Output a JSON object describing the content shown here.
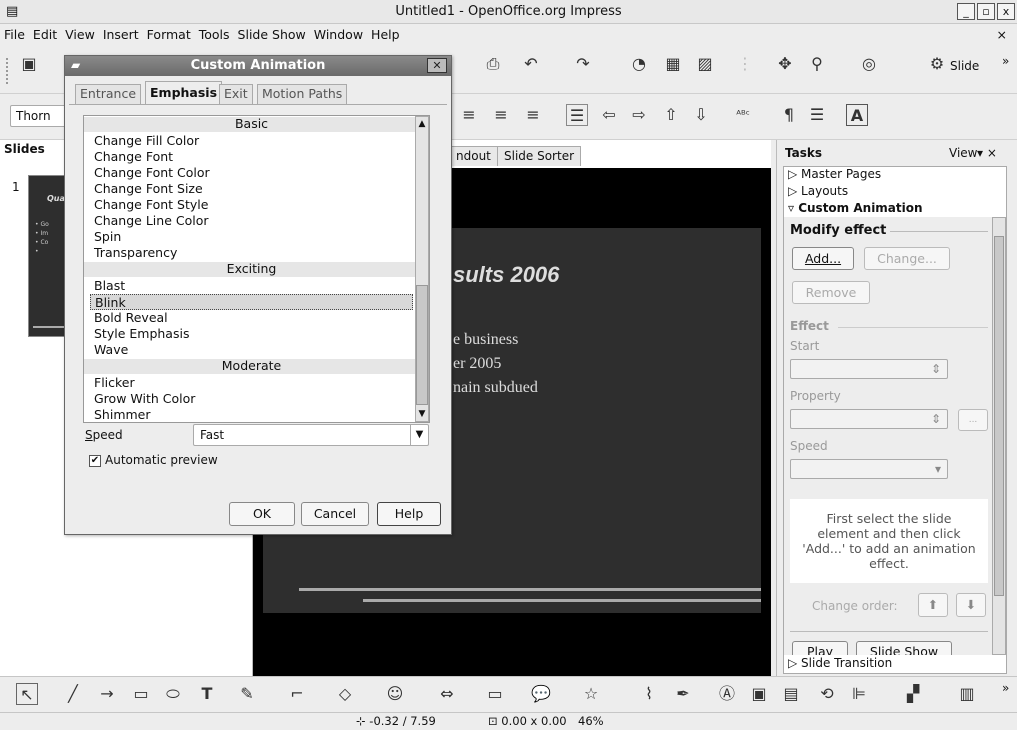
{
  "window": {
    "title": "Untitled1 - OpenOffice.org Impress",
    "btn_min": "_",
    "btn_max": "▫",
    "btn_close": "x",
    "menu_close": "×"
  },
  "menu": [
    "File",
    "Edit",
    "View",
    "Insert",
    "Format",
    "Tools",
    "Slide Show",
    "Window",
    "Help"
  ],
  "toolbar1": {
    "slide_btn": "Slide",
    "overflow": "»"
  },
  "toolbar2": {
    "font_name": "Thorn",
    "text_tool": "A"
  },
  "slides_panel": {
    "title": "Slides",
    "slide_number": "1",
    "thumb_title": "Qua",
    "thumb_bullets": [
      "• Go",
      "• Im",
      "• Co",
      "•"
    ]
  },
  "workarea": {
    "tabs": [
      "ndout",
      "Slide Sorter"
    ],
    "slide_title": "sults 2006",
    "lines": [
      "e business",
      "er 2005",
      "nain subdued"
    ]
  },
  "tasks": {
    "title": "Tasks",
    "view": "View",
    "sections": [
      "Master Pages",
      "Layouts",
      "Custom Animation"
    ],
    "modify_effect": "Modify effect",
    "add": "Add...",
    "change": "Change...",
    "remove": "Remove",
    "effect": "Effect",
    "start": "Start",
    "property": "Property",
    "speed": "Speed",
    "ellipsis": "...",
    "hint": "First select the slide element and then click 'Add...' to add an animation effect.",
    "change_order": "Change order:",
    "play": "Play",
    "slide_show": "Slide Show",
    "slide_transition": "Slide Transition"
  },
  "dialog": {
    "title": "Custom Animation",
    "tabs": [
      "Entrance",
      "Emphasis",
      "Exit",
      "Motion Paths"
    ],
    "selected_tab": "Emphasis",
    "categories": [
      {
        "name": "Basic",
        "items": [
          "Change Fill Color",
          "Change Font",
          "Change Font Color",
          "Change Font Size",
          "Change Font Style",
          "Change Line Color",
          "Spin",
          "Transparency"
        ]
      },
      {
        "name": "Exciting",
        "items": [
          "Blast",
          "Blink",
          "Bold Reveal",
          "Style Emphasis",
          "Wave"
        ]
      },
      {
        "name": "Moderate",
        "items": [
          "Flicker",
          "Grow With Color",
          "Shimmer"
        ]
      }
    ],
    "selected_item": "Blink",
    "speed_label": "Speed",
    "speed_value": "Fast",
    "auto_preview": "Automatic preview",
    "auto_preview_checked": true,
    "ok": "OK",
    "cancel": "Cancel",
    "help": "Help"
  },
  "status": {
    "position": "-0.32 / 7.59",
    "size": "0.00 x 0.00",
    "zoom": "46%"
  },
  "colors": {
    "dialog_title": "#7a7a7a",
    "slide_bg": "#2e2e2e",
    "selection": "#d8d8d8"
  }
}
